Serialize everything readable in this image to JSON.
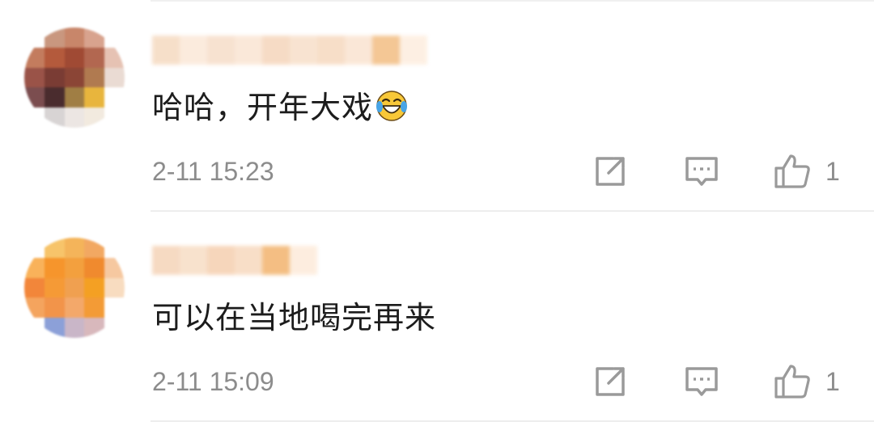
{
  "colors": {
    "text": "#1c1c1c",
    "meta": "#8c8c8c",
    "divider": "#ededed",
    "background": "#ffffff"
  },
  "comments": [
    {
      "text": "哈哈，开年大戏",
      "emoji": "laugh-cry-emoji",
      "time": "2-11 15:23",
      "likes": "1",
      "icons": [
        "share-icon",
        "reply-icon",
        "like-icon"
      ]
    },
    {
      "text": "可以在当地喝完再来",
      "time": "2-11 15:09",
      "likes": "1",
      "icons": [
        "share-icon",
        "reply-icon",
        "like-icon"
      ]
    }
  ]
}
